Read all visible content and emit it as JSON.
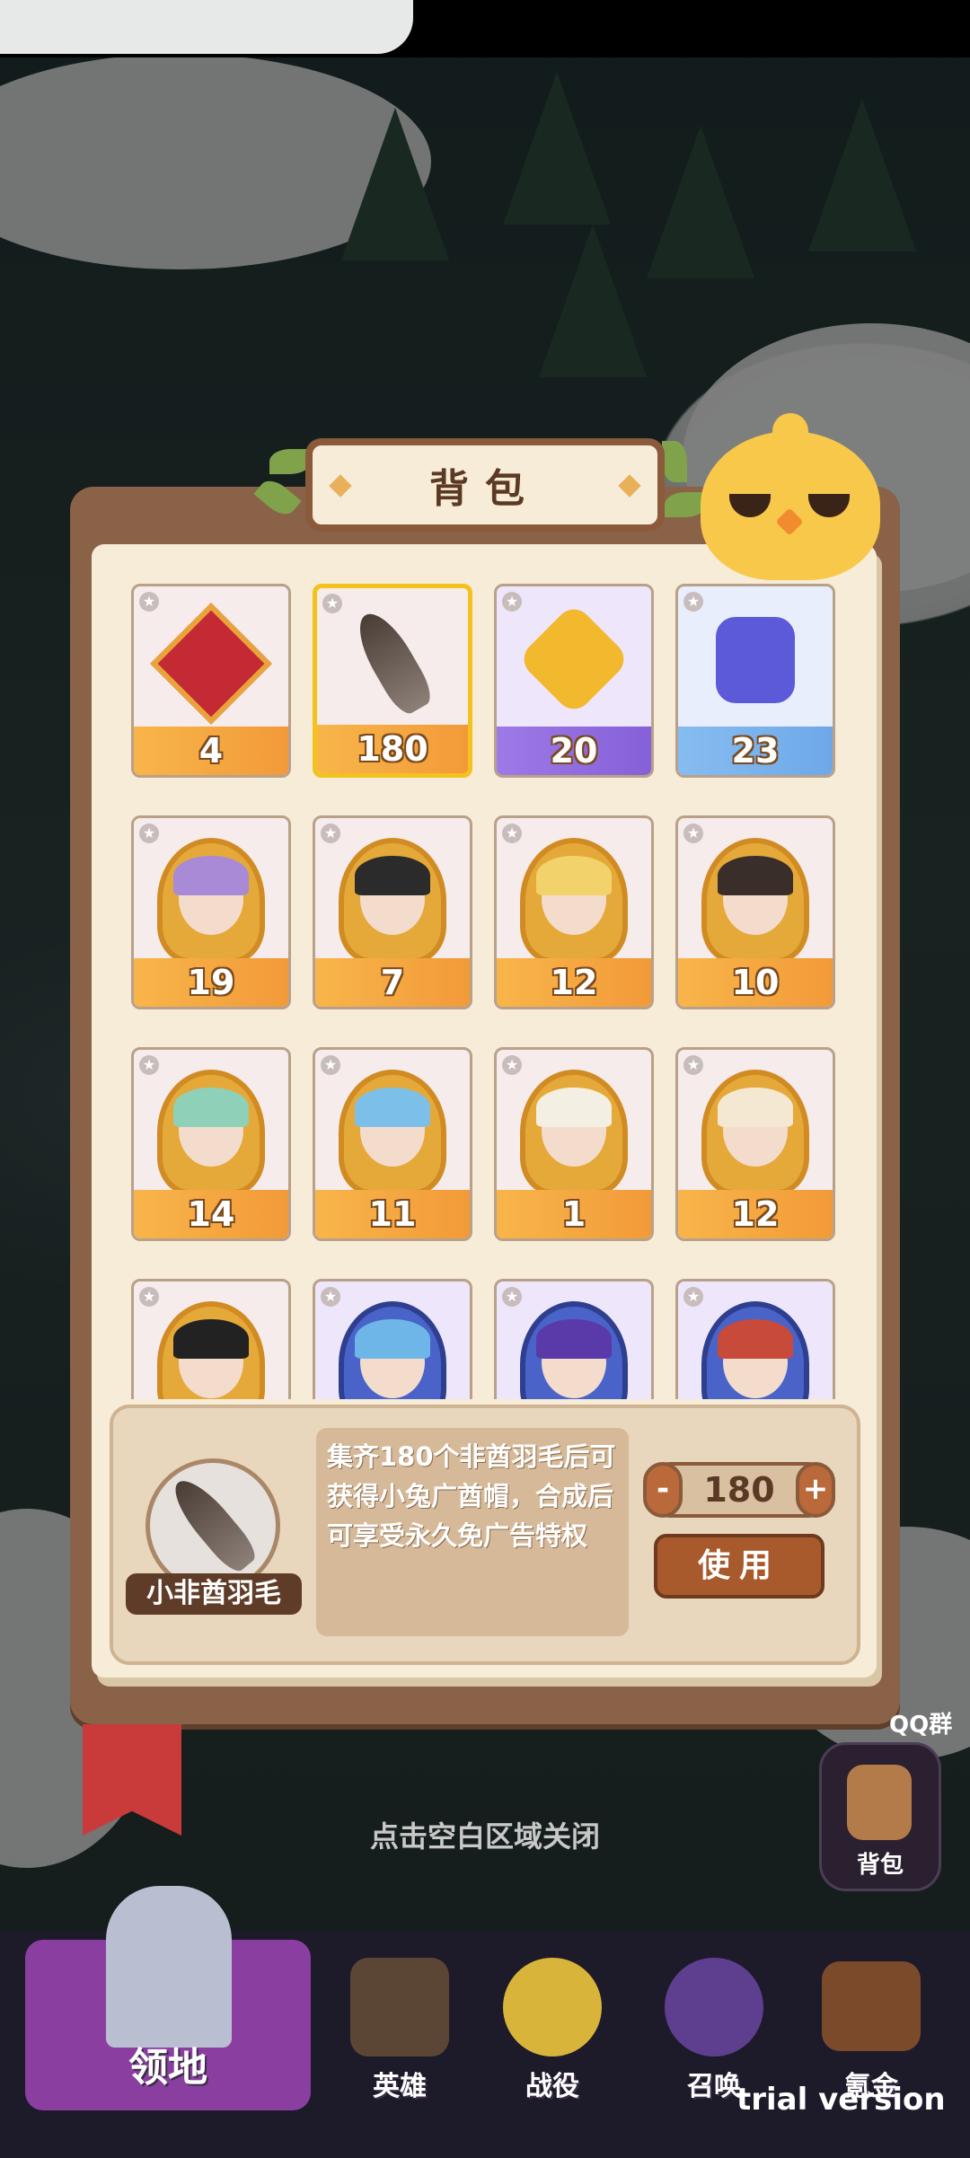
{
  "panel": {
    "title": "背包",
    "items": [
      {
        "icon": "red-gem-icon",
        "count": "4",
        "style": "orange",
        "selected": false
      },
      {
        "icon": "feather-icon",
        "count": "180",
        "style": "orange",
        "selected": true
      },
      {
        "icon": "gold-crystal-icon",
        "count": "20",
        "style": "purple",
        "selected": false
      },
      {
        "icon": "blue-crystal-icon",
        "count": "23",
        "style": "blue",
        "selected": false
      },
      {
        "icon": "hero-shard-icon",
        "count": "19",
        "style": "orange",
        "selected": false
      },
      {
        "icon": "hero-shard-icon",
        "count": "7",
        "style": "orange",
        "selected": false
      },
      {
        "icon": "hero-shard-icon",
        "count": "12",
        "style": "orange",
        "selected": false
      },
      {
        "icon": "hero-shard-icon",
        "count": "10",
        "style": "orange",
        "selected": false
      },
      {
        "icon": "hero-shard-icon",
        "count": "14",
        "style": "orange",
        "selected": false
      },
      {
        "icon": "hero-shard-icon",
        "count": "11",
        "style": "orange",
        "selected": false
      },
      {
        "icon": "hero-shard-icon",
        "count": "1",
        "style": "orange",
        "selected": false
      },
      {
        "icon": "hero-shard-icon",
        "count": "12",
        "style": "orange",
        "selected": false
      },
      {
        "icon": "hero-shard-icon",
        "count": "",
        "style": "orange",
        "selected": false
      },
      {
        "icon": "hero-shard-blue-icon",
        "count": "",
        "style": "purple",
        "selected": false
      },
      {
        "icon": "hero-shard-blue-icon",
        "count": "",
        "style": "purple",
        "selected": false
      },
      {
        "icon": "hero-shard-blue-icon",
        "count": "",
        "style": "purple",
        "selected": false
      }
    ]
  },
  "detail": {
    "item_name": "小非酋羽毛",
    "description": "集齐180个非酋羽毛后可获得小兔广酋帽，合成后可享受永久免广告特权",
    "quantity": "180",
    "minus_label": "-",
    "plus_label": "+",
    "use_label": "使用"
  },
  "close_hint": "点击空白区域关闭",
  "side": {
    "bag_label": "背包",
    "qq_label": "QQ群"
  },
  "nav": {
    "home": "领地",
    "heroes": "英雄",
    "battle": "战役",
    "summon": "召唤",
    "shop": "氪金"
  },
  "watermark": "trial version",
  "colors": {
    "accent": "#8a6248",
    "selected": "#f3c21d",
    "orange": "#f29a39",
    "purple": "#8560d9",
    "blue": "#6ea8e8"
  }
}
